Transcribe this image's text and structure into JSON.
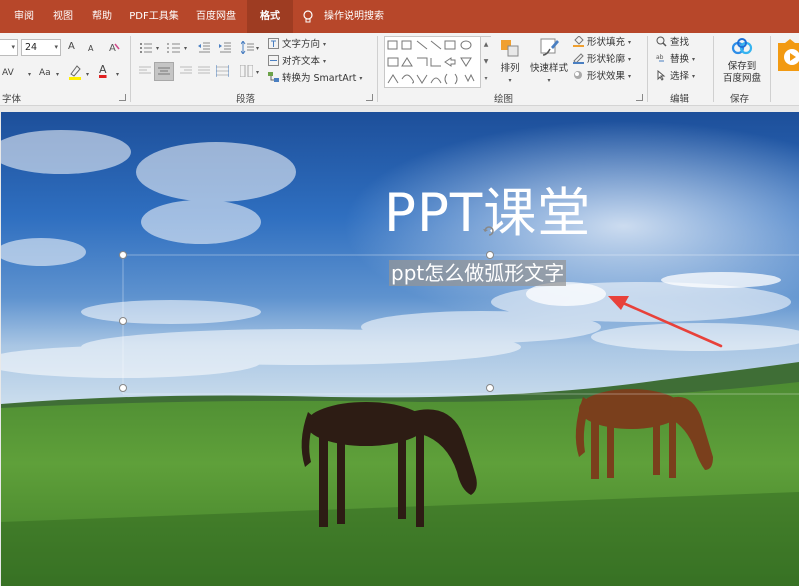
{
  "tabs": [
    {
      "label": "审阅",
      "active": false
    },
    {
      "label": "视图",
      "active": false
    },
    {
      "label": "帮助",
      "active": false
    },
    {
      "label": "PDF工具集",
      "active": false
    },
    {
      "label": "百度网盘",
      "active": false
    },
    {
      "label": "格式",
      "active": true
    }
  ],
  "tell_me": "操作说明搜索",
  "font_group": {
    "label": "字体",
    "size_value": "24",
    "grow_icon": "A",
    "shrink_icon": "A",
    "spacing_label": "AV",
    "case_label": "Aa",
    "color_label": "A"
  },
  "paragraph_group": {
    "label": "段落",
    "text_direction": "文字方向",
    "align_text": "对齐文本",
    "convert_smartart": "转换为 SmartArt"
  },
  "drawing_group": {
    "label": "绘图",
    "arrange": "排列",
    "quick_styles": "快速样式",
    "shape_fill": "形状填充",
    "shape_outline": "形状轮廓",
    "shape_effects": "形状效果"
  },
  "editing_group": {
    "label": "编辑",
    "find": "查找",
    "replace": "替换",
    "select": "选择"
  },
  "save_group": {
    "label": "保存",
    "save_to_cloud_line1": "保存到",
    "save_to_cloud_line2": "百度网盘"
  },
  "slide": {
    "title": "PPT课堂",
    "subtitle": "ppt怎么做弧形文字"
  },
  "colors": {
    "accent": "#b7472a",
    "active_tab": "#9e3c22",
    "arrow": "#e8413a"
  }
}
